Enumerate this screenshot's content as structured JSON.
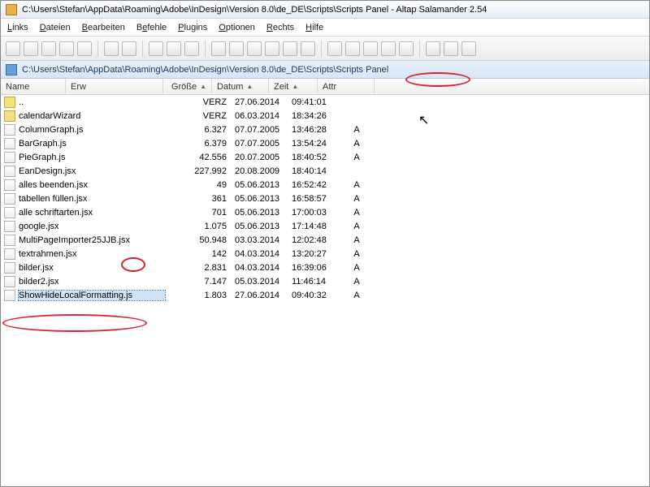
{
  "window": {
    "title": "C:\\Users\\Stefan\\AppData\\Roaming\\Adobe\\InDesign\\Version 8.0\\de_DE\\Scripts\\Scripts Panel - Altap Salamander 2.54"
  },
  "menu": {
    "links": "Links",
    "dateien": "Dateien",
    "bearbeiten": "Bearbeiten",
    "befehle": "Befehle",
    "plugins": "Plugins",
    "optionen": "Optionen",
    "rechts": "Rechts",
    "hilfe": "Hilfe"
  },
  "pathbar": {
    "text": "C:\\Users\\Stefan\\AppData\\Roaming\\Adobe\\InDesign\\Version 8.0\\de_DE\\Scripts\\Scripts Panel"
  },
  "headers": {
    "name": "Name",
    "erw": "Erw",
    "size": "Größe",
    "date": "Datum",
    "time": "Zeit",
    "attr": "Attr"
  },
  "rows": [
    {
      "icon": "up",
      "name": "..",
      "size": "VERZ",
      "date": "27.06.2014",
      "time": "09:41:01",
      "attr": ""
    },
    {
      "icon": "fld",
      "name": "calendarWizard",
      "size": "VERZ",
      "date": "06.03.2014",
      "time": "18:34:26",
      "attr": ""
    },
    {
      "icon": "js",
      "name": "ColumnGraph.js",
      "size": "6.327",
      "date": "07.07.2005",
      "time": "13:46:28",
      "attr": "A"
    },
    {
      "icon": "js",
      "name": "BarGraph.js",
      "size": "6.379",
      "date": "07.07.2005",
      "time": "13:54:24",
      "attr": "A"
    },
    {
      "icon": "js",
      "name": "PieGraph.js",
      "size": "42.556",
      "date": "20.07.2005",
      "time": "18:40:52",
      "attr": "A"
    },
    {
      "icon": "js",
      "name": "EanDesign.jsx",
      "size": "227.992",
      "date": "20.08.2009",
      "time": "18:40:14",
      "attr": ""
    },
    {
      "icon": "js",
      "name": "alles beenden.jsx",
      "size": "49",
      "date": "05.06.2013",
      "time": "16:52:42",
      "attr": "A"
    },
    {
      "icon": "js",
      "name": "tabellen füllen.jsx",
      "size": "361",
      "date": "05.06.2013",
      "time": "16:58:57",
      "attr": "A"
    },
    {
      "icon": "js",
      "name": "alle schriftarten.jsx",
      "size": "701",
      "date": "05.06.2013",
      "time": "17:00:03",
      "attr": "A"
    },
    {
      "icon": "js",
      "name": "google.jsx",
      "size": "1.075",
      "date": "05.06.2013",
      "time": "17:14:48",
      "attr": "A"
    },
    {
      "icon": "js",
      "name": "MultiPageImporter25JJB.jsx",
      "size": "50.948",
      "date": "03.03.2014",
      "time": "12:02:48",
      "attr": "A"
    },
    {
      "icon": "js",
      "name": "textrahmen.jsx",
      "size": "142",
      "date": "04.03.2014",
      "time": "13:20:27",
      "attr": "A"
    },
    {
      "icon": "js",
      "name": "bilder.jsx",
      "size": "2.831",
      "date": "04.03.2014",
      "time": "16:39:06",
      "attr": "A"
    },
    {
      "icon": "js",
      "name": "bilder2.jsx",
      "size": "7.147",
      "date": "05.03.2014",
      "time": "11:46:14",
      "attr": "A"
    },
    {
      "icon": "js",
      "name": "ShowHideLocalFormatting.js",
      "size": "1.803",
      "date": "27.06.2014",
      "time": "09:40:32",
      "attr": "A",
      "selected": true
    }
  ]
}
